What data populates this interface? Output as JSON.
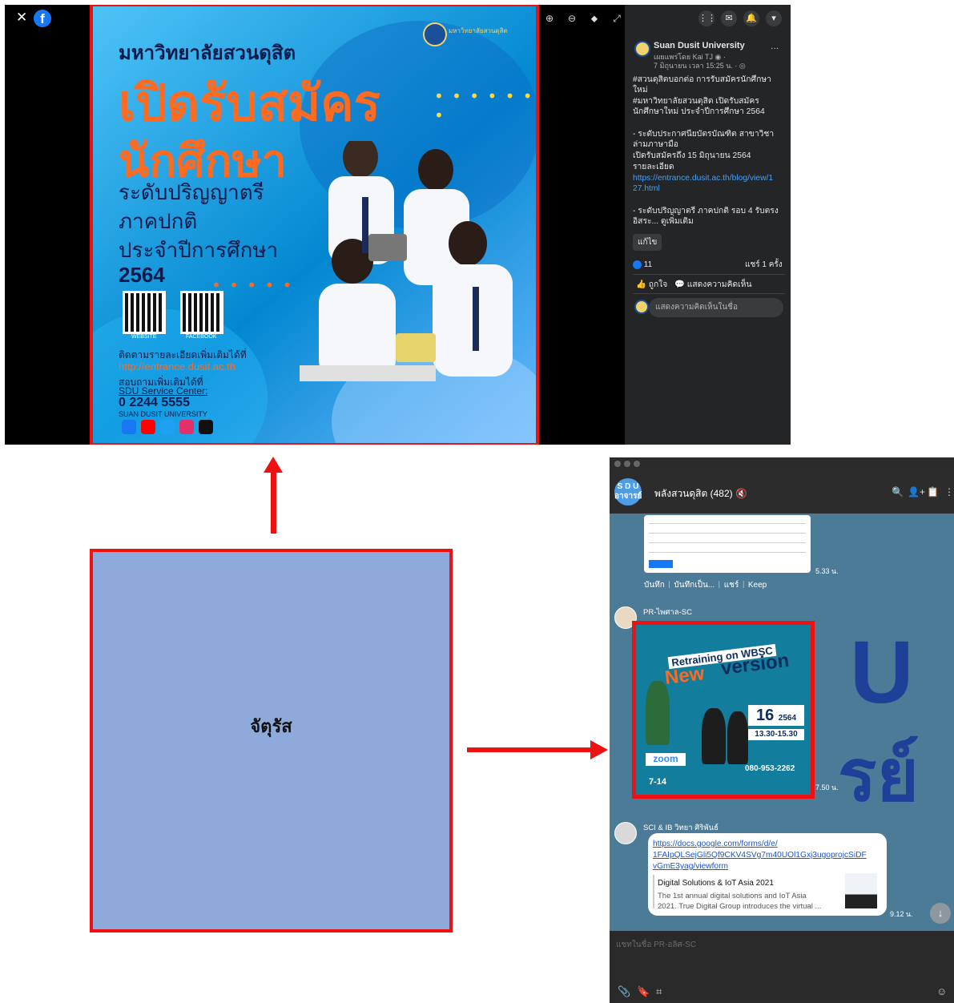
{
  "facebook": {
    "logo_glyph": "f",
    "close_glyph": "✕",
    "tools": [
      "⊕",
      "⊖",
      "⬥",
      "⤢"
    ],
    "poster": {
      "line1": "มหาวิทยาลัยสวนดุสิต",
      "line2": "เปิดรับสมัคร",
      "line3": "นักศึกษา",
      "line4": "ระดับปริญญาตรี",
      "line5": "ภาคปกติ",
      "line6": "ประจำปีการศึกษา",
      "line7": "2564",
      "dots": "• • • • • • •",
      "dots2": "• • • • •",
      "logo_text": "มหาวิทยาลัยสวนดุสิต",
      "qr_label_1": "WEBSITE",
      "qr_label_2": "FACEBOOK",
      "follow_text": "ติดตามรายละเอียดเพิ่มเติมได้ที่",
      "url": "http://entrance.dusit.ac.th",
      "ask_text": "สอบถามเพิ่มเติมได้ที่",
      "service": "SDU Service Center:",
      "phone": "0 2244 5555",
      "univ_en": "SUAN DUSIT UNIVERSITY"
    },
    "side": {
      "page_name": "Suan Dusit University",
      "published_by": "เผยแพร่โดย Kai TJ ◉ ·",
      "date": "7 มิถุนายน เวลา 15:25 น. · ◎",
      "more": "···",
      "lines": [
        "#สวนดุสิตบอกต่อ การรับสมัครนักศึกษา",
        "ใหม่",
        "#มหาวิทยาลัยสวนดุสิต เปิดรับสมัคร",
        "นักศึกษาใหม่ ประจำปีการศึกษา 2564",
        "",
        "- ระดับประกาศนียบัตรบัณฑิต สาขาวิชา",
        "ล่ามภาษามือ",
        "เปิดรับสมัครถึง 15 มิถุนายน 2564",
        "รายละเอียด"
      ],
      "link1": "https://entrance.dusit.ac.th/blog/view/1",
      "link2": "27.html",
      "more_lines": [
        "- ระดับปริญญาตรี ภาคปกติ รอบ 4 รับตรง",
        "อิสระ... ดูเพิ่มเติม"
      ],
      "edit_button": "แก้ไข",
      "likes": "11",
      "shares": "แชร์ 1 ครั้ง",
      "like_action": "ถูกใจ",
      "comment_action": "แสดงความคิดเห็น",
      "comment_placeholder": "แสดงความคิดเห็นในชื่อ",
      "top_icons": [
        "⋮⋮",
        "✉",
        "🔔",
        "▾"
      ]
    }
  },
  "diagram": {
    "square_label": "จัตุรัส"
  },
  "line_chat": {
    "avatar_text_1": "S D U",
    "avatar_text_2": "อาจารย์",
    "title": "พลังสวนดุสิต (482) 🔇",
    "header_icons": [
      "🔍",
      "👤+",
      "📋",
      "⋮"
    ],
    "sched_time": "5.33 น.",
    "sched_actions": "บันทึก ᛁ บันทึกเป็น... ᛁ แชร์ ᛁ Keep",
    "sender1": "PR-ไพศาล-SC",
    "wbsc": {
      "line1": "Retraining on WBSC",
      "line2": "New",
      "line3": "version",
      "day": "16",
      "year": "2564",
      "time": "13.30-15.30",
      "zoom": "zoom",
      "phone": "080-953-2262",
      "dates": "7-14"
    },
    "wbsc_time": "7.50 น.",
    "sender2": "SCI & IB วิทยา ศิริพันธ์",
    "link_lines": [
      "https://docs.google.com/forms/d/e/",
      "1FAIpQLSejGli5Qf9CKV4SVg7m40UOl1Gxj3ugoprojcSiDF",
      "vGmE3yag/viewform"
    ],
    "preview_title": "Digital Solutions & IoT Asia 2021",
    "preview_desc_1": "The 1st annual digital solutions and IoT Asia",
    "preview_desc_2": "2021. True Digital Group introduces the virtual ...",
    "bubble_time": "9.12 น.",
    "down_glyph": "↓",
    "composer_placeholder": "แชทในชื่อ PR-อลิศ-SC",
    "composer_icons": [
      "📎",
      "🔖",
      "⌗",
      "☺"
    ],
    "big_letter_1": "U",
    "big_letter_2": "รย์"
  }
}
